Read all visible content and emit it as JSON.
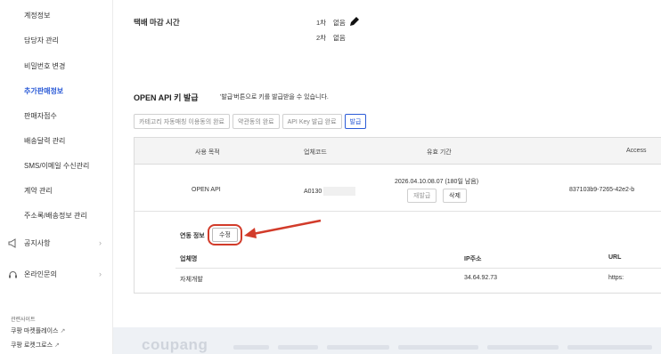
{
  "sidebar": {
    "items": [
      {
        "label": "계정정보"
      },
      {
        "label": "담당자 관리"
      },
      {
        "label": "비밀번호 변경"
      },
      {
        "label": "추가판매정보"
      },
      {
        "label": "판매자점수"
      },
      {
        "label": "배송달력 관리"
      },
      {
        "label": "SMS/이메일 수신관리"
      },
      {
        "label": "계약 관리"
      },
      {
        "label": "주소록/배송정보 관리"
      }
    ],
    "active_index": 3,
    "sub": [
      {
        "label": "공지사항",
        "icon": "megaphone-icon"
      },
      {
        "label": "온라인문의",
        "icon": "headset-icon"
      }
    ],
    "related_heading": "관련사이트",
    "related": [
      {
        "label": "쿠팡 마켓플레이스"
      },
      {
        "label": "쿠팡 로켓그로스"
      }
    ]
  },
  "delivery": {
    "title": "택배 마감 시간",
    "row1_label": "1차",
    "row1_value": "없음",
    "row2_label": "2차",
    "row2_value": "없음"
  },
  "api": {
    "title": "OPEN API 키 발급",
    "desc": "'발급'버튼으로 키를 발급받을 수 있습니다.",
    "buttons": [
      {
        "label": "카테고리 자동매칭 이용동의 완료"
      },
      {
        "label": "약관동의 완료"
      },
      {
        "label": "API Key 발급 완료"
      }
    ],
    "issue_button": "발급"
  },
  "table": {
    "headers": [
      "사용 목적",
      "업체코드",
      "유효 기간",
      "Access"
    ],
    "row": {
      "purpose": "OPEN API",
      "vendor_code": "A0130",
      "expiry": "2026.04.10.08.07 (180일 남음)",
      "reissue": "재발급",
      "delete": "삭제",
      "access": "837103b9-7265-42e2-b"
    },
    "link_label": "연동 정보",
    "edit_label": "수정",
    "sub_headers": [
      "업체명",
      "IP주소",
      "URL"
    ],
    "sub_row": {
      "name": "자체개발",
      "ip": "34.64.92.73",
      "url": "https:"
    }
  },
  "footer": {
    "logo": "coupang"
  },
  "colors": {
    "accent": "#2b5bd7",
    "annotation": "#d23b2a"
  }
}
